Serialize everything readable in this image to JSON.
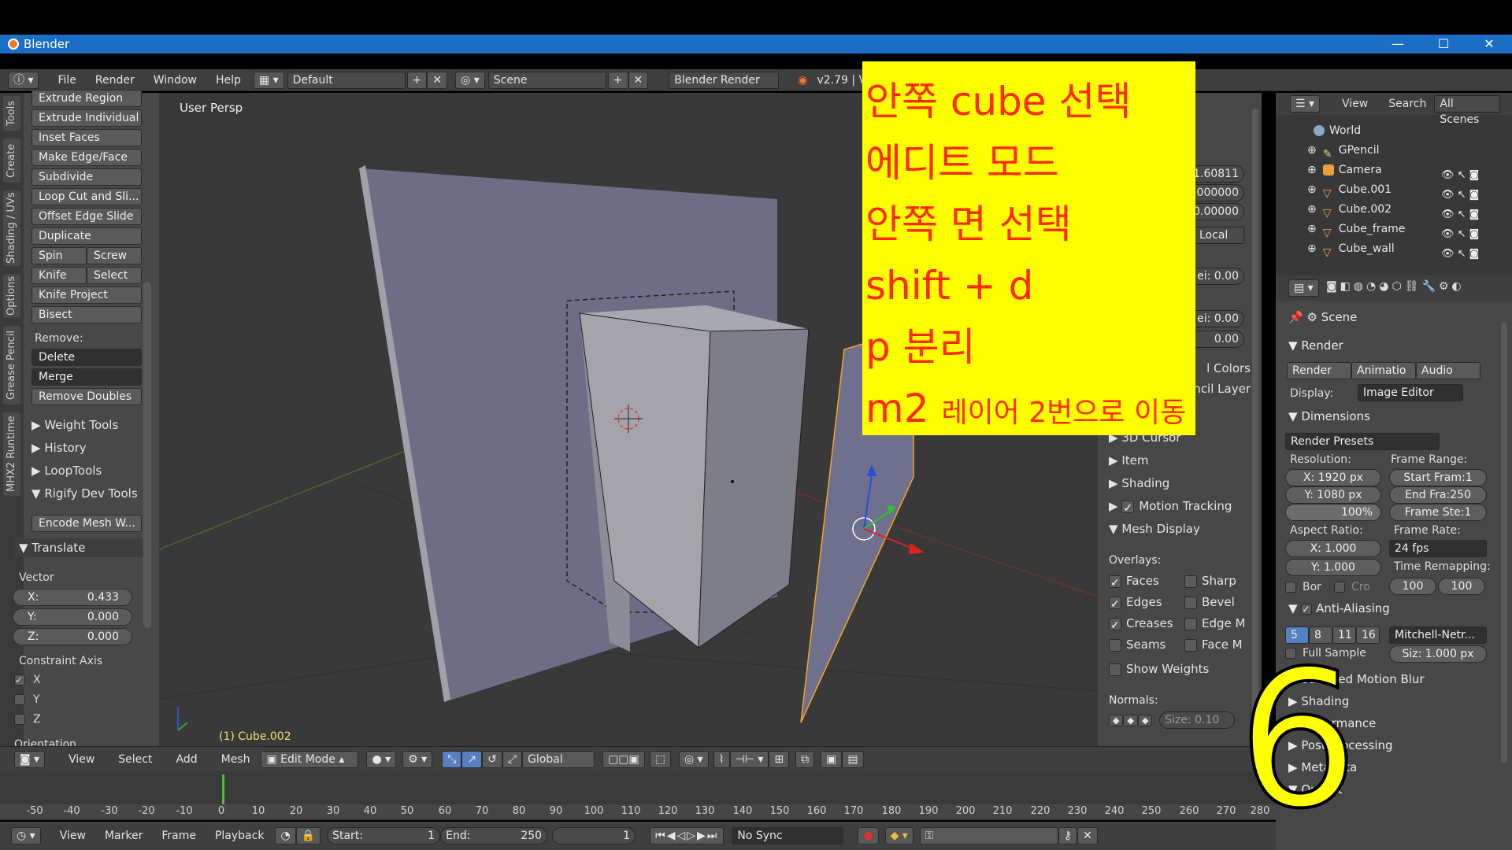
{
  "window": {
    "title": "Blender",
    "minimize": "—",
    "maximize": "☐",
    "close": "✕"
  },
  "info": {
    "menus": [
      "File",
      "Render",
      "Window",
      "Help"
    ],
    "layout": "Default",
    "scene": "Scene",
    "engine": "Blender Render",
    "version": "v2.79 | Verts:"
  },
  "tool_tabs": [
    "Tools",
    "Create",
    "Shading / UVs",
    "Options",
    "Grease Pencil",
    "MHX2 Runtime"
  ],
  "toolshelf": {
    "buttons": [
      "Extrude Region",
      "Extrude Individual",
      "Inset Faces",
      "Make Edge/Face",
      "Subdivide",
      "Loop Cut and Sli...",
      "Offset Edge Slide",
      "Duplicate"
    ],
    "pairs": [
      [
        "Spin",
        "Screw"
      ],
      [
        "Knife",
        "Select"
      ]
    ],
    "more": [
      "Knife Project",
      "Bisect"
    ],
    "remove_label": "Remove:",
    "remove_menus": [
      "Delete",
      "Merge"
    ],
    "remove_doubles": "Remove Doubles",
    "panels": [
      "Weight Tools",
      "History",
      "LoopTools",
      "Rigify Dev Tools"
    ],
    "encode": "Encode Mesh W...",
    "translate": {
      "title": "Translate",
      "vector_label": "Vector",
      "x_label": "X:",
      "x": "0.433",
      "y_label": "Y:",
      "y": "0.000",
      "z_label": "Z:",
      "z": "0.000",
      "constraint_label": "Constraint Axis",
      "axes": [
        "X",
        "Y",
        "Z"
      ],
      "orientation_label": "Orientation"
    }
  },
  "viewport": {
    "persp": "User Persp",
    "object": "(1) Cube.002"
  },
  "npanel": {
    "fields": [
      "1.60811",
      "0.000000",
      "0.00000",
      "Local",
      "ei: 0.00",
      "ei: 0.00",
      "0.00"
    ],
    "partial": [
      "l Colors",
      "encil Layer"
    ],
    "panels": [
      "3D Cursor",
      "Item",
      "Shading",
      "Motion Tracking",
      "Mesh Display"
    ],
    "overlays_label": "Overlays:",
    "overlays_left": [
      "Faces",
      "Edges",
      "Creases",
      "Seams"
    ],
    "overlays_right": [
      "Sharp",
      "Bevel",
      "Edge M",
      "Face M"
    ],
    "show_weights": "Show Weights",
    "normals_label": "Normals:",
    "size": "Size:  0.10"
  },
  "outliner": {
    "header": [
      "View",
      "Search",
      "All Scenes"
    ],
    "items": [
      "World",
      "GPencil",
      "Camera",
      "Cube.001",
      "Cube.002",
      "Cube_frame",
      "Cube_wall"
    ]
  },
  "properties": {
    "scene": "Scene",
    "render_title": "Render",
    "render_buttons": [
      "Render",
      "Animatio",
      "Audio"
    ],
    "display_label": "Display:",
    "display_value": "Image Editor",
    "dimensions_title": "Dimensions",
    "render_presets": "Render Presets",
    "resolution_label": "Resolution:",
    "frame_range_label": "Frame Range:",
    "res_x": "X:    1920 px",
    "res_y": "Y:    1080 px",
    "res_pct": "100%",
    "start": "Start Fram:1",
    "end": "End Fra:250",
    "step": "Frame Ste:1",
    "aspect_label": "Aspect Ratio:",
    "frame_rate_label": "Frame Rate:",
    "asp_x": "X:      1.000",
    "asp_y": "Y:      1.000",
    "fps": "24 fps",
    "time_remap_label": "Time Remapping:",
    "bor": "Bor",
    "cro": "Cro",
    "remap_old": "100",
    "remap_new": "100",
    "aa_title": "Anti-Aliasing",
    "aa_samples": [
      "5",
      "8",
      "11",
      "16"
    ],
    "aa_filter": "Mitchell-Netr...",
    "full_sample": "Full Sample",
    "filter_size": "Siz: 1.000 px",
    "panels": [
      "Sampled Motion Blur",
      "Shading",
      "Performance",
      "Post Processing",
      "Metadata",
      "Output"
    ]
  },
  "view_header": {
    "menus": [
      "View",
      "Select",
      "Add",
      "Mesh"
    ],
    "mode": "Edit Mode",
    "orientation": "Global"
  },
  "timeline": {
    "ticks": [
      "-50",
      "-40",
      "-30",
      "-20",
      "-10",
      "0",
      "10",
      "20",
      "30",
      "40",
      "50",
      "60",
      "70",
      "80",
      "90",
      "100",
      "110",
      "120",
      "130",
      "140",
      "150",
      "160",
      "170",
      "180",
      "190",
      "200",
      "210",
      "220",
      "230",
      "240",
      "250",
      "260",
      "270",
      "280"
    ],
    "menus": [
      "View",
      "Marker",
      "Frame",
      "Playback"
    ],
    "start": "Start:",
    "start_val": "1",
    "end": "End:",
    "end_val": "250",
    "current": "1",
    "sync": "No Sync"
  },
  "overlay": {
    "lines": [
      "안쪽 cube 선택",
      "에디트 모드",
      "안쪽 면 선택",
      "shift + d",
      "p 분리"
    ],
    "last_big": "m2",
    "last_small": "레이어 2번으로 이동"
  },
  "big_number": "6",
  "colors": {
    "titlebar": "#1a6fc4",
    "overlay": "#ffff00",
    "overlay_text": "#ff2a00",
    "selection": "#f5a623"
  }
}
